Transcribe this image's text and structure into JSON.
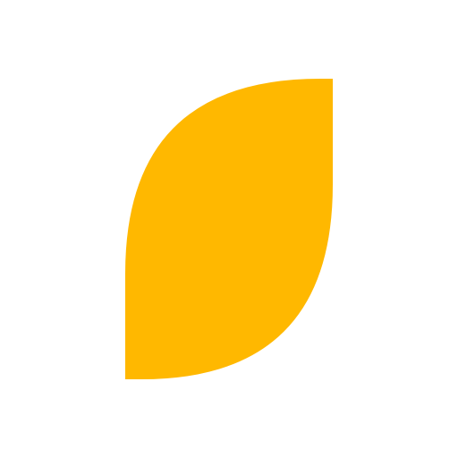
{
  "icon": {
    "name": "leaf-icon",
    "color": "#FFB800",
    "background": "#FFFFFF"
  }
}
